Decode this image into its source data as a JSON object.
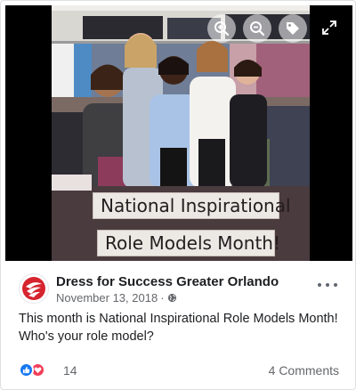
{
  "media": {
    "caption_line1": "National Inspirational",
    "caption_line2": "Role Models Month!"
  },
  "post": {
    "page_name": "Dress for Success Greater Orlando",
    "date": "November 13, 2018",
    "separator": "·",
    "text": "This month is National Inspirational Role Models Month! Who's your role model?"
  },
  "engagement": {
    "reaction_count": "14",
    "comments": "4 Comments"
  },
  "colors": {
    "like": "#1877f2",
    "love": "#f33e58",
    "brand": "#d6242f"
  },
  "icons": [
    "zoom-in-icon",
    "zoom-out-icon",
    "tag-icon",
    "expand-icon",
    "globe-icon",
    "more-options-icon",
    "like-icon",
    "love-icon"
  ]
}
